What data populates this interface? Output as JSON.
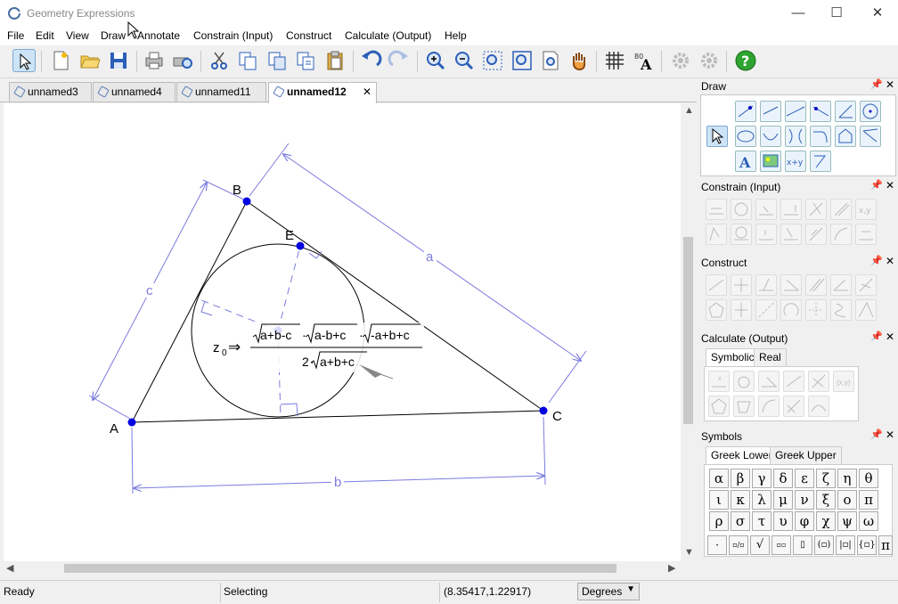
{
  "window": {
    "title": "Geometry Expressions",
    "minimize": "—",
    "maximize": "☐",
    "close": "✕"
  },
  "menu": [
    "File",
    "Edit",
    "View",
    "Draw",
    "Annotate",
    "Constrain (Input)",
    "Construct",
    "Calculate (Output)",
    "Help"
  ],
  "toolbar": {
    "icons": [
      "select-arrow-icon",
      "new-file-icon",
      "open-folder-icon",
      "save-disk-icon",
      "print-icon",
      "print-preview-icon",
      "cut-icon",
      "copy-icon",
      "copy-as-icon",
      "copy-special-icon",
      "paste-icon",
      "undo-icon",
      "redo-icon",
      "zoom-in-icon",
      "zoom-out-icon",
      "zoom-box-icon",
      "zoom-fit-icon",
      "zoom-page-icon",
      "pan-hand-icon",
      "grid-icon",
      "font-icon",
      "settings-gear-icon",
      "settings-gear-2-icon",
      "help-icon"
    ]
  },
  "tabs": [
    {
      "label": "unnamed3",
      "active": false
    },
    {
      "label": "unnamed4",
      "active": false
    },
    {
      "label": "unnamed11",
      "active": false
    },
    {
      "label": "unnamed12",
      "active": true
    }
  ],
  "drawing": {
    "points": {
      "A": "A",
      "B": "B",
      "C": "C",
      "E": "E"
    },
    "sides": {
      "a": "a",
      "b": "b",
      "c": "c"
    },
    "expression": {
      "lhs": "z",
      "sub": "0",
      "arrow": "⇒",
      "num1": "a+b-c",
      "num2": "a-b+c",
      "num3": "-a+b+c",
      "den_coef": "2",
      "den_root": "a+b+c",
      "dot": "·"
    },
    "colors": {
      "point": "#0000e0",
      "dimension": "#7b7bdf",
      "line": "#000000"
    }
  },
  "panels": {
    "draw": {
      "title": "Draw"
    },
    "constrain": {
      "title": "Constrain (Input)"
    },
    "construct": {
      "title": "Construct"
    },
    "calculate": {
      "title": "Calculate (Output)",
      "tabs": [
        "Symbolic",
        "Real"
      ]
    },
    "symbols": {
      "title": "Symbols",
      "tabs": [
        "Greek Lower",
        "Greek Upper"
      ],
      "greek": [
        "α",
        "β",
        "γ",
        "δ",
        "ε",
        "ζ",
        "η",
        "θ",
        "ι",
        "κ",
        "λ",
        "μ",
        "ν",
        "ξ",
        "ο",
        "π",
        "ρ",
        "σ",
        "τ",
        "υ",
        "φ",
        "χ",
        "ψ",
        "ω"
      ],
      "bottom": [
        "·",
        "▫/▫",
        "√",
        "▫▫",
        "▯",
        "(▫)",
        "|▫|",
        "{▫}",
        "π"
      ]
    }
  },
  "status": {
    "ready": "Ready",
    "mode": "Selecting",
    "coords": "(8.35417,1.22917)",
    "units": "Degrees"
  }
}
